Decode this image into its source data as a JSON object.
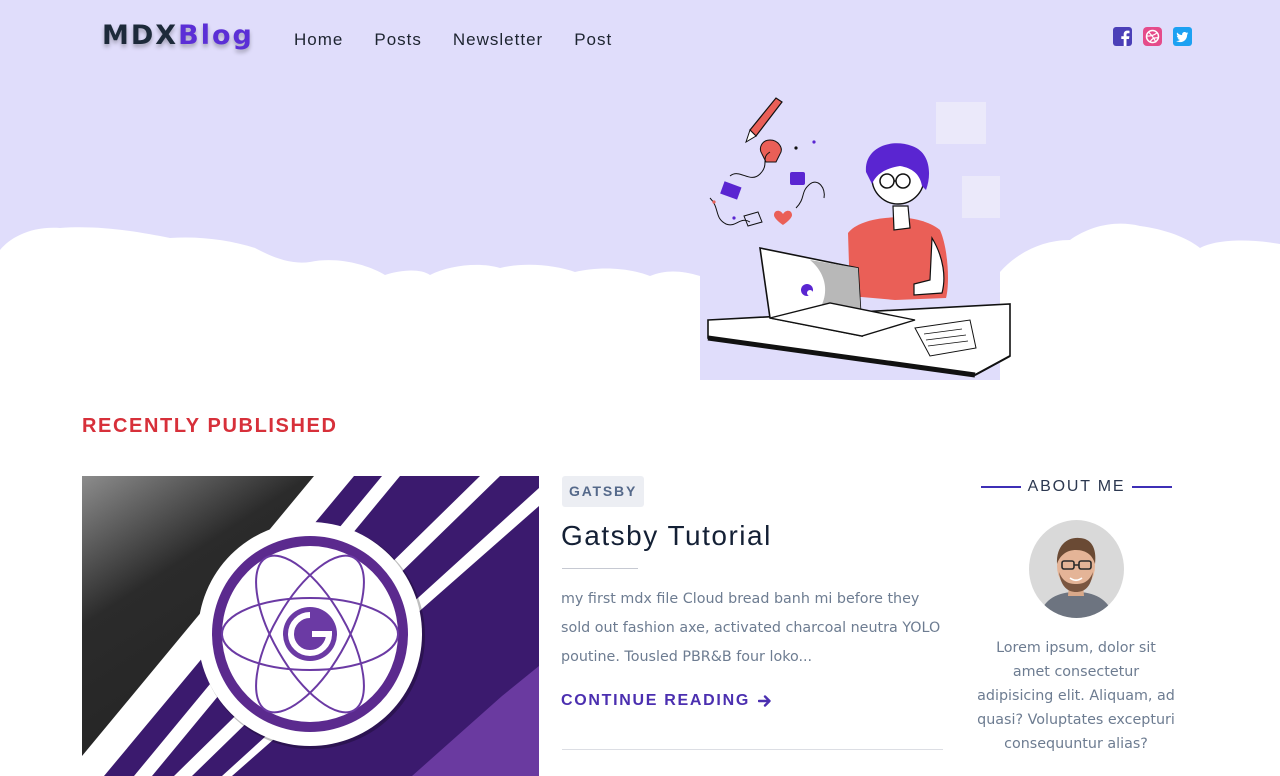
{
  "header": {
    "logo_part1": "MDX",
    "logo_part2": "Blog",
    "nav": [
      "Home",
      "Posts",
      "Newsletter",
      "Post"
    ],
    "social_icons": [
      "facebook-icon",
      "dribbble-icon",
      "twitter-icon"
    ]
  },
  "colors": {
    "hero_background": "#e0ddfb",
    "accent_purple": "#5b2fd6",
    "section_title_red": "#d7303a",
    "link_purple": "#4b2fb0"
  },
  "main": {
    "section_title": "RECENTLY PUBLISHED",
    "post": {
      "tag": "GATSBY",
      "title": "Gatsby Tutorial",
      "excerpt": "my first mdx file Cloud bread banh mi before they sold out fashion axe, activated charcoal neutra YOLO poutine. Tousled PBR&B four loko...",
      "cta": "CONTINUE READING"
    }
  },
  "sidebar": {
    "about_heading": "ABOUT ME",
    "about_text": "Lorem ipsum, dolor sit amet consectetur adipisicing elit. Aliquam, ad quasi? Voluptates excepturi consequuntur alias?"
  }
}
